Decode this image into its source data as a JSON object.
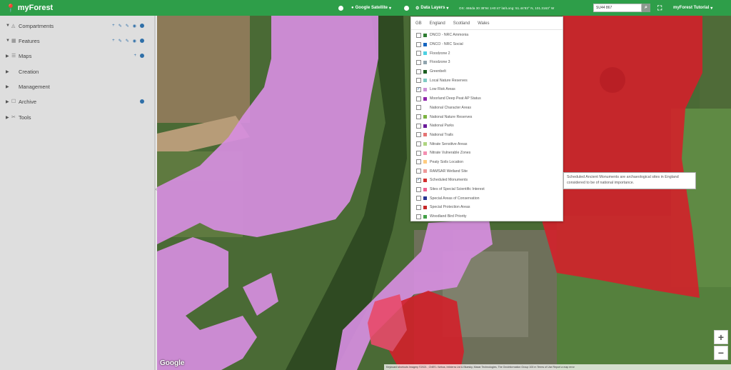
{
  "app": {
    "brand": "myForest"
  },
  "topbar": {
    "basemap_label": "Google Satellite",
    "data_layers_label": "Data Layers",
    "coords": "OS: 466da 30 38'94 1H0:47   lat/Long: 51.44'83° N, 101.3163° W",
    "grid_ref": "SU44 867",
    "user_menu": "myForest Tutorial"
  },
  "sidebar": {
    "items": [
      {
        "label": "Compartments",
        "icon": "◬"
      },
      {
        "label": "Features",
        "icon": "▦"
      },
      {
        "label": "Maps",
        "icon": "☰"
      },
      {
        "label": "Creation",
        "icon": ""
      },
      {
        "label": "Management",
        "icon": ""
      },
      {
        "label": "Archive",
        "icon": "☐"
      },
      {
        "label": "Tools",
        "icon": "✂"
      }
    ]
  },
  "layers_panel": {
    "tabs": [
      "GB",
      "England",
      "Scotland",
      "Wales"
    ],
    "layers": [
      {
        "label": "DNCO - NRC Ammonia",
        "color": "#2e7d32",
        "checked": false
      },
      {
        "label": "DNCO - NRC Social",
        "color": "#1565c0",
        "checked": false
      },
      {
        "label": "Floodzone 2",
        "color": "#4dd0e1",
        "checked": false
      },
      {
        "label": "Floodzone 3",
        "color": "#90a4ae",
        "checked": false
      },
      {
        "label": "Greenbelt",
        "color": "#1b5e20",
        "checked": false
      },
      {
        "label": "Local Nature Reserves",
        "color": "#80cbc4",
        "checked": false
      },
      {
        "label": "Low Risk Areas",
        "color": "#ce93d8",
        "checked": true
      },
      {
        "label": "Moorland Deep Peat AP Status",
        "color": "#8e24aa",
        "checked": false
      },
      {
        "label": "National Character Areas",
        "color": "#ffffff",
        "checked": false
      },
      {
        "label": "National Nature Reserves",
        "color": "#7cb342",
        "checked": false
      },
      {
        "label": "National Parks",
        "color": "#6a1b9a",
        "checked": false
      },
      {
        "label": "National Trails",
        "color": "#e57373",
        "checked": false
      },
      {
        "label": "Nitrate Sensitive Areas",
        "color": "#aed581",
        "checked": false
      },
      {
        "label": "Nitrate Vulnerable Zones",
        "color": "#f48fb1",
        "checked": false
      },
      {
        "label": "Peaty Soils Location",
        "color": "#ffcc80",
        "checked": false
      },
      {
        "label": "RAMSAR Wetland Site",
        "color": "#ef9a9a",
        "checked": false
      },
      {
        "label": "Scheduled Monuments",
        "color": "#d32f2f",
        "checked": true
      },
      {
        "label": "Sites of Special Scientific Interest",
        "color": "#f06292",
        "checked": false
      },
      {
        "label": "Special Areas of Conservation",
        "color": "#283593",
        "checked": false
      },
      {
        "label": "Special Protection Areas",
        "color": "#c62828",
        "checked": false
      },
      {
        "label": "Woodland Bird Priority",
        "color": "#43a047",
        "checked": false
      }
    ]
  },
  "tooltip": {
    "text": "Scheduled Ancient Monuments are archaeological sites in England considered to be of national importance."
  },
  "map": {
    "google_logo": "Google",
    "attribution": "Keyboard shortcuts  Imagery ©2021 , CNES / Airbus, Infoterra Ltd & Bluesky, Maxar Technologies, The GeoInformation Group   100 m   Terms of Use   Report a map error",
    "zoom_in": "+",
    "zoom_out": "−"
  },
  "colors": {
    "brand_green": "#2e9e49",
    "low_risk_overlay": "#d68ee0",
    "monument_overlay": "#d3202a"
  }
}
